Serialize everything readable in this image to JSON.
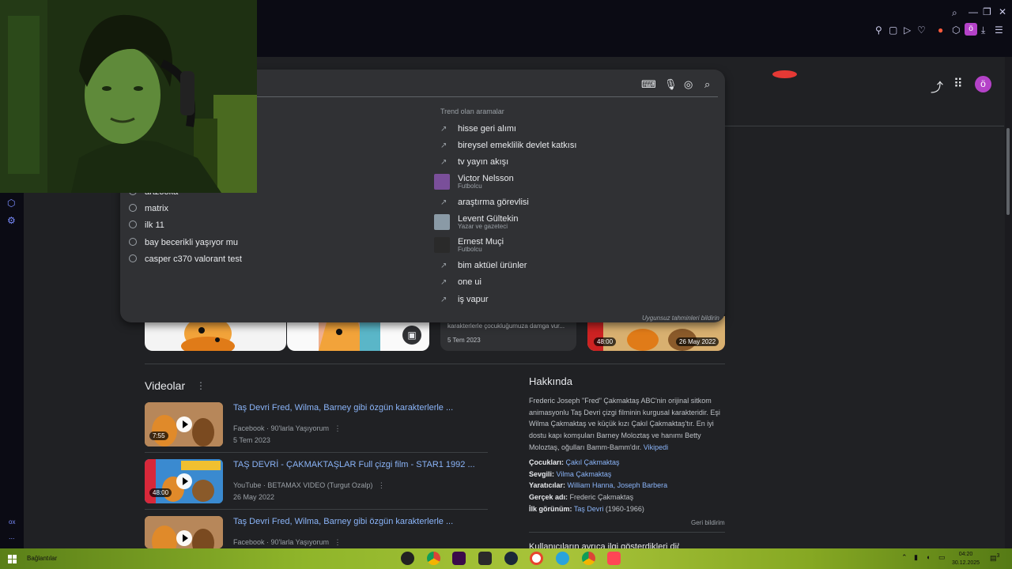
{
  "browser": {
    "profile_initial": "ö",
    "icons": [
      "search-icon",
      "minimize-icon",
      "restore-icon",
      "close-icon",
      "pin-icon",
      "screenshot-icon",
      "play-icon",
      "heart-icon",
      "extension-icon",
      "puzzle-icon",
      "download-icon",
      "menu-icon"
    ]
  },
  "sidebar": {
    "icons": [
      "extension-icon",
      "settings-icon",
      "ox-label",
      "more-icon"
    ],
    "ox_label": "ox",
    "more_label": "..."
  },
  "google_header": {
    "avatar_initial": "ö",
    "icons": [
      "share-icon",
      "apps-grid-icon"
    ]
  },
  "search": {
    "icons": [
      "keyboard-icon",
      "microphone-icon",
      "lens-icon",
      "search-icon"
    ],
    "recent": [
      {
        "label": "artzooka",
        "visible_partial": true
      },
      {
        "label": "matrix"
      },
      {
        "label": "ilk 11"
      },
      {
        "label": "bay becerikli yaşıyor mu"
      },
      {
        "label": "casper c370 valorant test"
      }
    ],
    "trending_title": "Trend olan aramalar",
    "trending": [
      {
        "label": "hisse geri alımı"
      },
      {
        "label": "bireysel emeklilik devlet katkısı"
      },
      {
        "label": "tv yayın akışı"
      },
      {
        "label": "Victor Nelsson",
        "sub": "Futbolcu",
        "thumb_color": "#7a4f9a"
      },
      {
        "label": "araştırma görevlisi"
      },
      {
        "label": "Levent Gültekin",
        "sub": "Yazar ve gazeteci",
        "thumb_color": "#8a9aa6"
      },
      {
        "label": "Ernest Muçi",
        "sub": "Futbolcu",
        "thumb_color": "#2a2a2a"
      },
      {
        "label": "bim aktüel ürünler"
      },
      {
        "label": "one ui"
      },
      {
        "label": "iş vapur"
      }
    ],
    "report_label": "Uygunsuz tahminleri bildirin"
  },
  "image_strip": {
    "news_text": "karakterlerle çocukluğumuza damga vur...",
    "news_date": "5 Tem 2023",
    "video_duration": "48:00",
    "video_date": "26 May 2022"
  },
  "videos": {
    "title": "Videolar",
    "menu_icon": "more-vert-icon",
    "items": [
      {
        "title": "Taş Devri Fred, Wilma, Barney gibi özgün karakterlerle ...",
        "source": "Facebook",
        "channel": "90'larla Yaşıyorum",
        "date": "5 Tem 2023",
        "duration": "7:55"
      },
      {
        "title": "TAŞ DEVRİ - ÇAKMAKTAŞLAR Full çizgi film - STAR1 1992 ...",
        "source": "YouTube",
        "channel": "BETAMAX VIDEO (Turgut Ozalp)",
        "date": "26 May 2022",
        "duration": "48:00"
      },
      {
        "title": "Taş Devri Fred, Wilma, Barney gibi özgün karakterlerle ...",
        "source": "Facebook",
        "channel": "90'larla Yaşıyorum"
      }
    ]
  },
  "knowledge_panel": {
    "title": "Hakkında",
    "description": "Frederic Joseph \"Fred\" Çakmaktaş ABC'nin orijinal sitkom animasyonlu Taş Devri çizgi filminin kurgusal karakteridir. Eşi Wilma Çakmaktaş ve küçük kızı Çakıl Çakmaktaş'tır. En iyi dostu kapı komşuları Barney Moloztaş ve hanımı Betty Moloztaş, oğulları Bamm-Bamm'dır.",
    "source_link": "Vikipedi",
    "facts": [
      {
        "label": "Çocukları:",
        "value": "Çakıl Çakmaktaş",
        "link": true
      },
      {
        "label": "Sevgili:",
        "value": "Vilma Çakmaktaş",
        "link": true
      },
      {
        "label": "Yaratıcılar:",
        "value": "William Hanna, Joseph Barbera",
        "link": true
      },
      {
        "label": "Gerçek adı:",
        "value": "Frederic Çakmaktaş",
        "link": false
      },
      {
        "label": "İlk görünüm:",
        "value": "Taş Devri",
        "extra": "(1960-1966)",
        "link": true
      }
    ],
    "feedback": "Geri bildirim",
    "more_heading_partial": "Kullanıcıların ayrıca ilgi gösterdikleri diğer aramalar"
  },
  "taskbar": {
    "connections_label": "Bağlantılar",
    "time": "04:20",
    "date": "30.12.2025",
    "notification_count": "3",
    "apps": [
      {
        "name": "obs-app",
        "color": "#222"
      },
      {
        "name": "chrome-app",
        "color": "#e6e6e6"
      },
      {
        "name": "vs-app",
        "color": "#3b0a4a"
      },
      {
        "name": "epic-app",
        "color": "#2a2a2a"
      },
      {
        "name": "steam-app",
        "color": "#1b2838"
      },
      {
        "name": "opera-app",
        "color": "#fff"
      },
      {
        "name": "telegram-app",
        "color": "#2aa3dc"
      },
      {
        "name": "chrome-beta-app",
        "color": "#e6e6e6"
      },
      {
        "name": "valorant-app",
        "color": "#ff4655"
      }
    ]
  }
}
